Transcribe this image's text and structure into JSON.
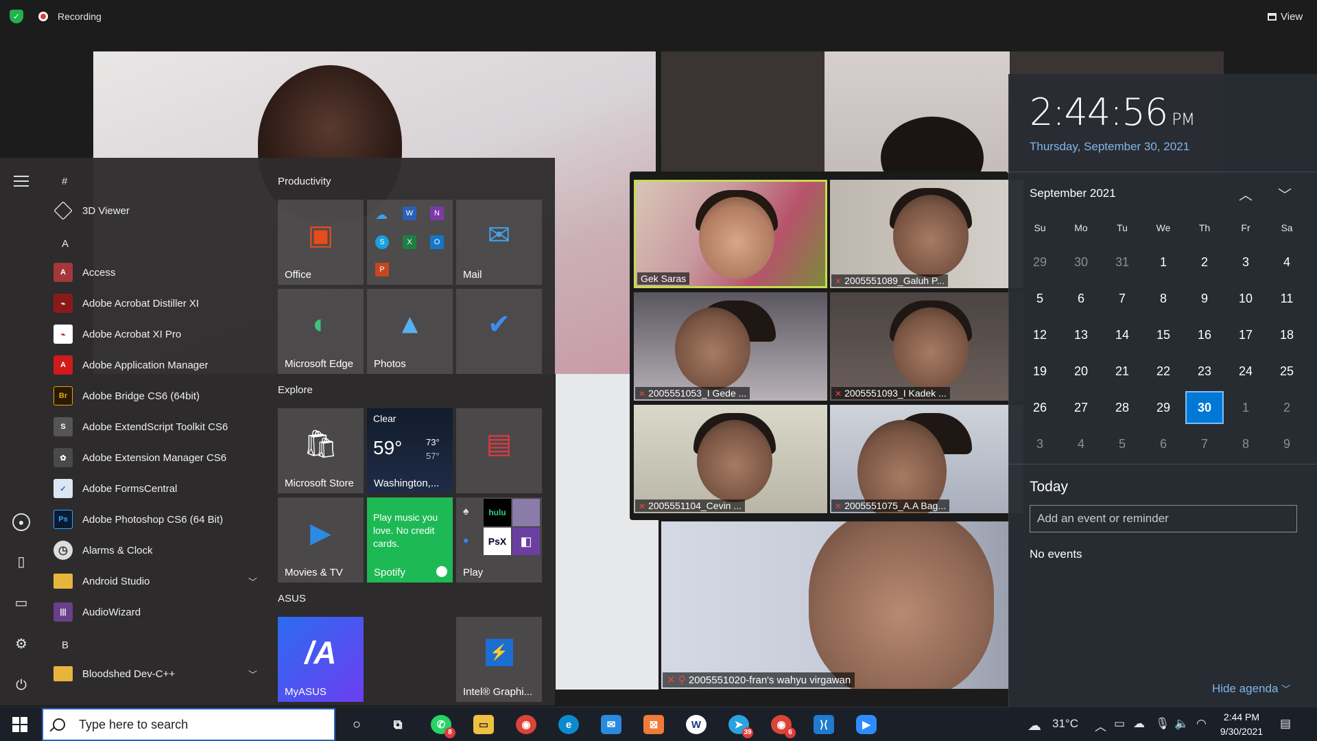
{
  "recording": {
    "label": "Recording"
  },
  "view_button": {
    "label": "View"
  },
  "gallery": {
    "tiles": [
      {
        "name": "Gek Saras"
      },
      {
        "name": "2005551089_Galuh P..."
      },
      {
        "name": "2005551053_I Gede ..."
      },
      {
        "name": "2005551093_I Kadek ..."
      },
      {
        "name": "2005551104_Cevin ..."
      },
      {
        "name": "2005551075_A.A Bag..."
      }
    ],
    "bottom_name": "2005551020-fran's wahyu virgawan"
  },
  "start_menu": {
    "letters": {
      "hash": "#",
      "a": "A",
      "b": "B"
    },
    "apps": [
      {
        "label": "3D Viewer",
        "icon": "cube-icon"
      },
      {
        "label": "Access",
        "icon": "access-icon",
        "abbr": "A"
      },
      {
        "label": "Adobe Acrobat Distiller XI",
        "icon": "acrobat-distiller-icon",
        "abbr": "⌁"
      },
      {
        "label": "Adobe Acrobat XI Pro",
        "icon": "acrobat-icon",
        "abbr": "⌁"
      },
      {
        "label": "Adobe Application Manager",
        "icon": "application-manager-icon",
        "abbr": "A"
      },
      {
        "label": "Adobe Bridge CS6 (64bit)",
        "icon": "bridge-icon",
        "abbr": "Br"
      },
      {
        "label": "Adobe ExtendScript Toolkit CS6",
        "icon": "extendscript-icon",
        "abbr": "S"
      },
      {
        "label": "Adobe Extension Manager CS6",
        "icon": "extension-manager-icon",
        "abbr": "✿"
      },
      {
        "label": "Adobe FormsCentral",
        "icon": "formscentral-icon",
        "abbr": "✓"
      },
      {
        "label": "Adobe Photoshop CS6 (64 Bit)",
        "icon": "photoshop-icon",
        "abbr": "Ps"
      },
      {
        "label": "Alarms & Clock",
        "icon": "clock-icon",
        "abbr": "◷"
      },
      {
        "label": "Android Studio",
        "icon": "folder-icon"
      },
      {
        "label": "AudioWizard",
        "icon": "audiowizard-icon",
        "abbr": "|||"
      },
      {
        "label": "Bloodshed Dev-C++",
        "icon": "folder-icon"
      }
    ],
    "groups": {
      "productivity": "Productivity",
      "explore": "Explore",
      "asus": "ASUS"
    },
    "tiles": {
      "office": "Office",
      "mail": "Mail",
      "edge": "Microsoft Edge",
      "photos": "Photos",
      "store": "Microsoft Store",
      "weather_condition": "Clear",
      "weather_temp": "59°",
      "weather_high": "73°",
      "weather_low": "57°",
      "weather_city": "Washington,...",
      "movies": "Movies & TV",
      "spotify_promo": "Play music you love. No credit cards.",
      "spotify": "Spotify",
      "play": "Play",
      "myasus": "MyASUS",
      "intel": "Intel® Graphi..."
    }
  },
  "calendar": {
    "time": "2:44:56",
    "ampm": "PM",
    "date": "Thursday, September 30, 2021",
    "month": "September 2021",
    "weekdays": [
      "Su",
      "Mo",
      "Tu",
      "We",
      "Th",
      "Fr",
      "Sa"
    ],
    "weeks": [
      [
        "29",
        "30",
        "31",
        "1",
        "2",
        "3",
        "4"
      ],
      [
        "5",
        "6",
        "7",
        "8",
        "9",
        "10",
        "11"
      ],
      [
        "12",
        "13",
        "14",
        "15",
        "16",
        "17",
        "18"
      ],
      [
        "19",
        "20",
        "21",
        "22",
        "23",
        "24",
        "25"
      ],
      [
        "26",
        "27",
        "28",
        "29",
        "30",
        "1",
        "2"
      ],
      [
        "3",
        "4",
        "5",
        "6",
        "7",
        "8",
        "9"
      ]
    ],
    "today_heading": "Today",
    "event_placeholder": "Add an event or reminder",
    "no_events": "No events",
    "hide_agenda": "Hide agenda"
  },
  "taskbar": {
    "search_placeholder": "Type here to search",
    "whatsapp_badge": "8",
    "telegram_badge": "39",
    "chrome_badge": "6",
    "weather_temp": "31°C",
    "time": "2:44 PM",
    "date": "9/30/2021"
  },
  "colors": {
    "accent": "#0078d7",
    "link": "#7fb7ea",
    "active_speaker": "#c6dc4e"
  }
}
